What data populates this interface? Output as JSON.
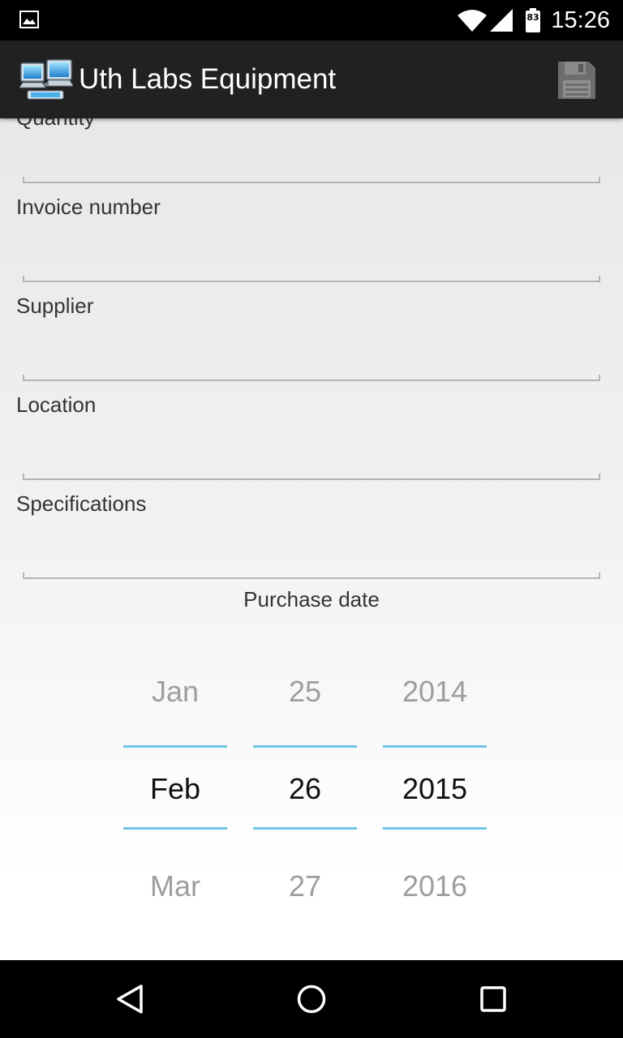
{
  "status_bar": {
    "time": "15:26",
    "battery_level": "83",
    "icons": [
      "gallery-icon",
      "wifi-icon",
      "signal-icon",
      "battery-icon"
    ]
  },
  "action_bar": {
    "title": "Uth Labs Equipment",
    "app_icon": "networked-computers-icon",
    "save_icon": "floppy-disk-icon"
  },
  "form": {
    "partial_label": "Quantity",
    "fields": [
      {
        "label": "",
        "value": ""
      },
      {
        "label": "Invoice number",
        "value": ""
      },
      {
        "label": "Supplier",
        "value": ""
      },
      {
        "label": "Location",
        "value": ""
      },
      {
        "label": "Specifications",
        "value": ""
      }
    ],
    "purchase_date_label": "Purchase date"
  },
  "date_picker": {
    "month": {
      "prev": "Jan",
      "selected": "Feb",
      "next": "Mar"
    },
    "day": {
      "prev": "25",
      "selected": "26",
      "next": "27"
    },
    "year": {
      "prev": "2014",
      "selected": "2015",
      "next": "2016"
    }
  },
  "nav_bar": {
    "icons": [
      "back-icon",
      "home-icon",
      "recents-icon"
    ]
  },
  "colors": {
    "action_bar": "#212121",
    "picker_accent": "#6ec5e8",
    "field_underline": "#b4b4b4"
  }
}
